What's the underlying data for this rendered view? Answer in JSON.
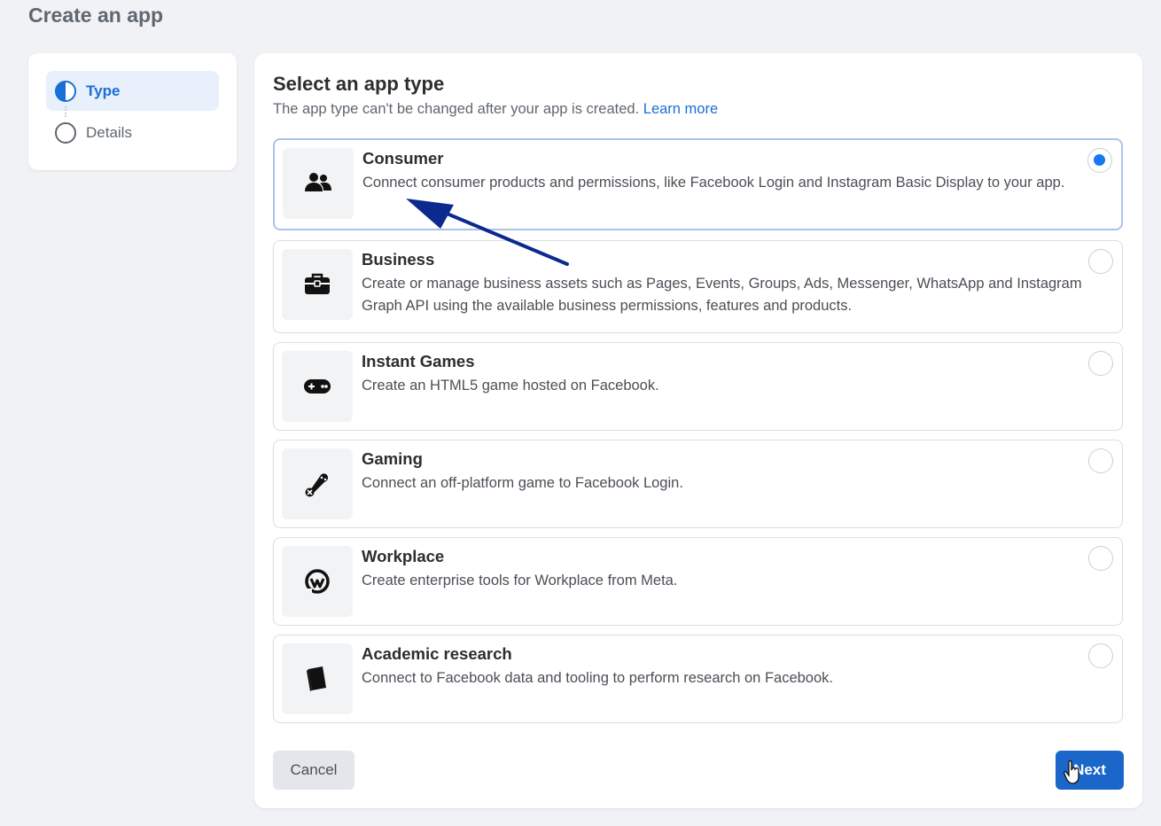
{
  "page": {
    "title": "Create an app"
  },
  "steps": [
    {
      "label": "Type",
      "state": "active",
      "icon": "half-circle-icon"
    },
    {
      "label": "Details",
      "state": "inactive",
      "icon": "empty-circle-icon"
    }
  ],
  "panel": {
    "heading": "Select an app type",
    "subtitle": "The app type can't be changed after your app is created.",
    "learn_more": "Learn more"
  },
  "options": [
    {
      "title": "Consumer",
      "description": "Connect consumer products and permissions, like Facebook Login and Instagram Basic Display to your app.",
      "icon": "people-icon",
      "selected": true
    },
    {
      "title": "Business",
      "description": "Create or manage business assets such as Pages, Events, Groups, Ads, Messenger, WhatsApp and Instagram Graph API using the available business permissions, features and products.",
      "icon": "briefcase-icon",
      "selected": false
    },
    {
      "title": "Instant Games",
      "description": "Create an HTML5 game hosted on Facebook.",
      "icon": "gamepad-icon",
      "selected": false
    },
    {
      "title": "Gaming",
      "description": "Connect an off-platform game to Facebook Login.",
      "icon": "game-controller-icon",
      "selected": false
    },
    {
      "title": "Workplace",
      "description": "Create enterprise tools for Workplace from Meta.",
      "icon": "workplace-icon",
      "selected": false
    },
    {
      "title": "Academic research",
      "description": "Connect to Facebook data and tooling to perform research on Facebook.",
      "icon": "book-icon",
      "selected": false
    }
  ],
  "footer": {
    "cancel_label": "Cancel",
    "next_label": "Next"
  },
  "colors": {
    "accent": "#1877f2",
    "button_primary": "#1b66c9",
    "annotation_arrow": "#0b2a8f"
  }
}
